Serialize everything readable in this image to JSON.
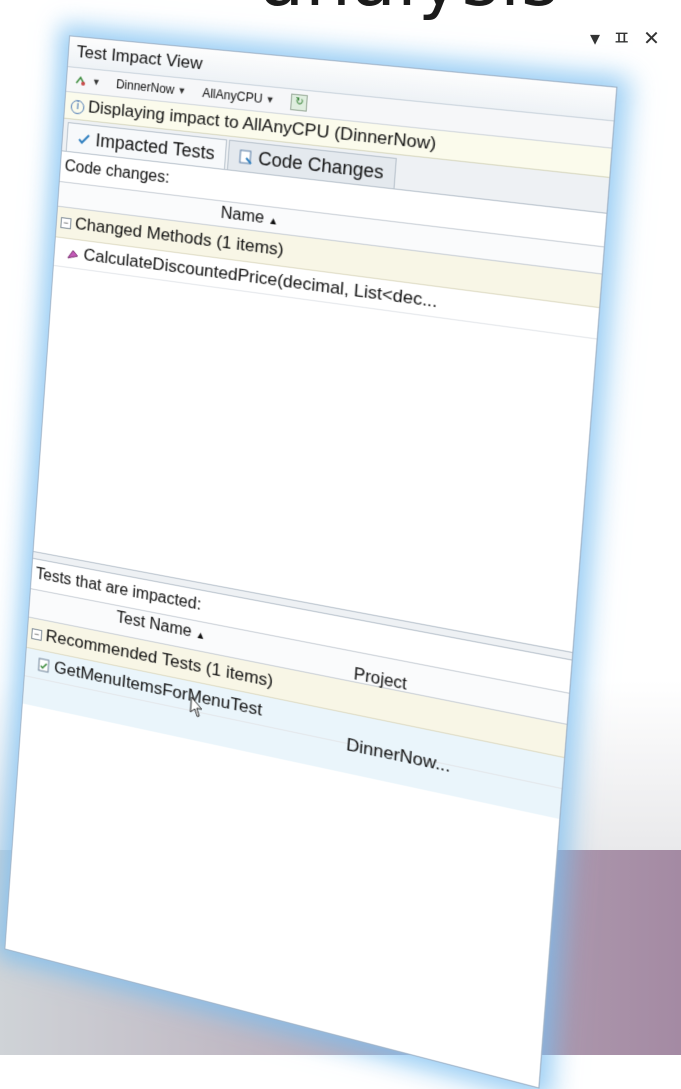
{
  "slide": {
    "heading_fragment": "analysis"
  },
  "pane_controls": {
    "dropdown": "▾",
    "pin": "ㅍ",
    "close": "✕"
  },
  "window": {
    "title": "Test Impact View",
    "toolbar": {
      "project_dropdown": "DinnerNow",
      "config_dropdown": "AllAnyCPU"
    },
    "info_message": "Displaying impact to AllAnyCPU (DinnerNow)",
    "tabs": [
      {
        "label": "Impacted Tests"
      },
      {
        "label": "Code Changes"
      }
    ],
    "code_changes": {
      "section_label": "Code changes:",
      "column_name": "Name",
      "group_label": "Changed Methods (1 items)",
      "items": [
        {
          "label": "CalculateDiscountedPrice(decimal, List<dec..."
        }
      ]
    },
    "impacted_tests": {
      "section_label": "Tests that are impacted:",
      "column_test_name": "Test Name",
      "column_project": "Project",
      "group_label": "Recommended Tests (1 items)",
      "items": [
        {
          "test_name": "GetMenuItemsForMenuTest",
          "project": "DinnerNow..."
        }
      ]
    }
  },
  "colors": {
    "glow": "#7fc2f0",
    "group_background": "#f8f6e6",
    "info_background": "#fbfbec"
  }
}
